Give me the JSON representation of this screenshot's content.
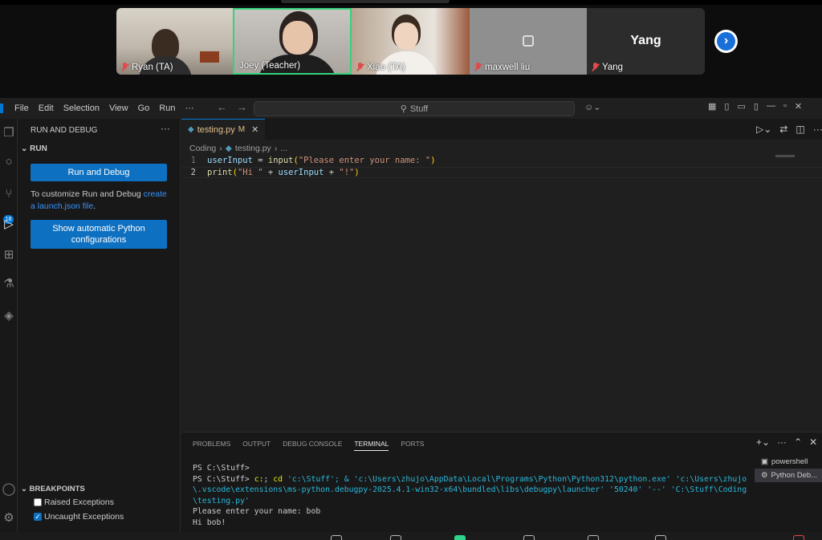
{
  "meeting": {
    "participants": [
      {
        "name": "Ryan (TA)",
        "muted": true
      },
      {
        "name": "Joey (Teacher)",
        "muted": false,
        "active_speaker": true
      },
      {
        "name": "Xiao (TA)",
        "muted": true
      },
      {
        "name": "maxwell liu",
        "muted": true
      },
      {
        "name": "Yang",
        "muted": true,
        "avatar_text": "Yang"
      }
    ],
    "next_icon": "›",
    "speaker_color": "#34d27b"
  },
  "titlebar": {
    "menus": [
      "File",
      "Edit",
      "Selection",
      "View",
      "Go",
      "Run",
      "···"
    ],
    "back": "←",
    "forward": "→",
    "search_text": "Stuff",
    "copilot_icon": "copilot-icon",
    "window_controls": [
      "—",
      "▫",
      "✕"
    ]
  },
  "activity": {
    "scm_badge": "18"
  },
  "sidebar": {
    "header": "RUN AND DEBUG",
    "more": "···",
    "section": "RUN",
    "run_button": "Run and Debug",
    "hint_prefix": "To customize Run and Debug ",
    "hint_link": "create a launch.json file",
    "hint_suffix": ".",
    "python_button": "Show automatic Python configurations",
    "breakpoints_header": "BREAKPOINTS",
    "breakpoints": [
      {
        "label": "Raised Exceptions",
        "checked": false
      },
      {
        "label": "Uncaught Exceptions",
        "checked": true
      }
    ]
  },
  "editor": {
    "tab_name": "testing.py",
    "tab_status": "M",
    "breadcrumb": [
      "Coding",
      "testing.py",
      "..."
    ],
    "lines": [
      {
        "num": "1",
        "code": "userInput = input(\"Please enter your name: \")"
      },
      {
        "num": "2",
        "code": "print(\"Hi \" + userInput + \"!\")"
      }
    ]
  },
  "panel": {
    "tabs": [
      "PROBLEMS",
      "OUTPUT",
      "DEBUG CONSOLE",
      "TERMINAL",
      "PORTS"
    ],
    "active_tab": "TERMINAL",
    "terminal": {
      "line1": "PS C:\\Stuff>",
      "cmd_prompt": "PS C:\\Stuff> ",
      "cmd_a": "c:",
      "cmd_b": "; ",
      "cmd_c": "cd",
      "cmd_rest": " 'c:\\Stuff'; & 'c:\\Users\\zhujo\\AppData\\Local\\Programs\\Python\\Python312\\python.exe' 'c:\\Users\\zhujo\\.vscode\\extensions\\ms-python.debugpy-2025.4.1-win32-x64\\bundled\\libs\\debugpy\\launcher' '50240' '--' 'C:\\Stuff\\Coding\\testing.py'",
      "line3": "Please enter your name: bob",
      "line4": "Hi bob!"
    },
    "terminals": [
      "powershell",
      "Python Deb..."
    ]
  }
}
